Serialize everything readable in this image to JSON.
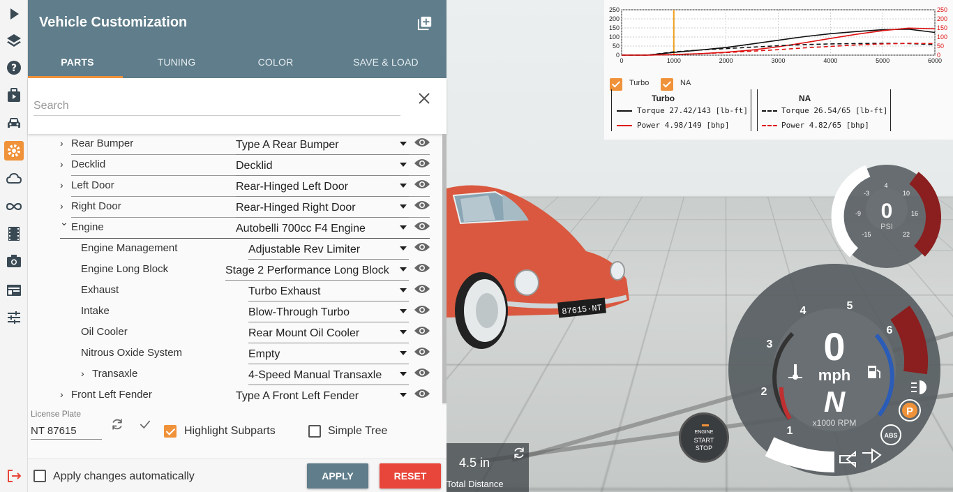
{
  "iconbar": {
    "items": [
      {
        "icon": "play-icon"
      },
      {
        "icon": "layers-icon"
      },
      {
        "icon": "help-icon"
      },
      {
        "icon": "mission-icon"
      },
      {
        "icon": "vehicle-icon"
      },
      {
        "icon": "gear-icon",
        "active": true
      },
      {
        "icon": "cloud-icon"
      },
      {
        "icon": "infinity-icon"
      },
      {
        "icon": "film-icon"
      },
      {
        "icon": "camera-icon"
      },
      {
        "icon": "layout-icon"
      },
      {
        "icon": "sliders-icon"
      }
    ],
    "exit_icon": "exit-icon"
  },
  "panel": {
    "title": "Vehicle Customization",
    "add_icon": "add-box-icon",
    "tabs": [
      "PARTS",
      "TUNING",
      "COLOR",
      "SAVE & LOAD"
    ],
    "active_tab": "PARTS",
    "search": {
      "placeholder": "Search",
      "value": ""
    },
    "parts": [
      {
        "name": "Rear Bumper",
        "value": "Type A Rear Bumper",
        "level": 0,
        "chevron": "›"
      },
      {
        "name": "Decklid",
        "value": "Decklid",
        "level": 0,
        "chevron": "›"
      },
      {
        "name": "Left Door",
        "value": "Rear-Hinged Left Door",
        "level": 0,
        "chevron": "›"
      },
      {
        "name": "Right Door",
        "value": "Rear-Hinged Right Door",
        "level": 0,
        "chevron": "›"
      },
      {
        "name": "Engine",
        "value": "Autobelli 700cc F4 Engine",
        "level": 0,
        "chevron": "⌄"
      },
      {
        "name": "Engine Management",
        "value": "Adjustable Rev Limiter",
        "level": 1
      },
      {
        "name": "Engine Long Block",
        "value": "Stage 2 Performance Long Block",
        "level": 1
      },
      {
        "name": "Exhaust",
        "value": "Turbo Exhaust",
        "level": 1
      },
      {
        "name": "Intake",
        "value": "Blow-Through Turbo",
        "level": 1
      },
      {
        "name": "Oil Cooler",
        "value": "Rear Mount Oil Cooler",
        "level": 1
      },
      {
        "name": "Nitrous Oxide System",
        "value": "Empty",
        "level": 1
      },
      {
        "name": "Transaxle",
        "value": "4-Speed Manual Transaxle",
        "level": 1,
        "chevron": "›"
      },
      {
        "name": "Front Left Fender",
        "value": "Type A Front Left Fender",
        "level": 0,
        "chevron": "›"
      }
    ],
    "license_plate": {
      "label": "License Plate",
      "value": "NT 87615"
    },
    "highlight_subparts": {
      "label": "Highlight Subparts",
      "checked": true
    },
    "simple_tree": {
      "label": "Simple Tree",
      "checked": false
    },
    "apply_auto": {
      "label": "Apply changes automatically",
      "checked": false
    },
    "apply_label": "APPLY",
    "reset_label": "RESET"
  },
  "chart": {
    "turbo_checkbox": "Turbo",
    "na_checkbox": "NA",
    "legend": {
      "turbo": {
        "title": "Turbo",
        "torque": "Torque 27.42/143 [lb-ft]",
        "power": "Power  4.98/149  [bhp]"
      },
      "na": {
        "title": "NA",
        "torque": "Torque 26.54/65 [lb-ft]",
        "power": "Power  4.82/65  [bhp]"
      }
    }
  },
  "chart_data": {
    "type": "line",
    "x_ticks": [
      "0",
      "1000",
      "2000",
      "3000",
      "4000",
      "5000",
      "6000"
    ],
    "y_left_ticks": [
      "250",
      "200",
      "150",
      "100",
      "50",
      "0"
    ],
    "y_right_ticks": [
      "250",
      "200",
      "150",
      "100",
      "50",
      "0"
    ],
    "xlim": [
      0,
      6000
    ],
    "ylim": [
      0,
      250
    ],
    "marker_rpm": 1000,
    "grid": true,
    "x": [
      0,
      500,
      1000,
      1500,
      2000,
      2500,
      3000,
      3500,
      4000,
      4500,
      5000,
      5500,
      6000
    ],
    "series": [
      {
        "name": "Turbo Torque",
        "values": [
          0,
          0,
          15,
          28,
          42,
          62,
          82,
          102,
          118,
          130,
          140,
          143,
          125
        ],
        "color": "#111111",
        "dash": false
      },
      {
        "name": "Turbo Power",
        "values": [
          0,
          0,
          3,
          8,
          16,
          28,
          46,
          68,
          92,
          115,
          135,
          149,
          145
        ],
        "color": "#dd1111",
        "dash": false
      },
      {
        "name": "NA Torque",
        "values": [
          0,
          0,
          18,
          28,
          36,
          44,
          52,
          58,
          62,
          64,
          65,
          64,
          58
        ],
        "color": "#111111",
        "dash": true
      },
      {
        "name": "NA Power",
        "values": [
          0,
          0,
          3,
          8,
          14,
          22,
          30,
          40,
          48,
          56,
          62,
          65,
          64
        ],
        "color": "#dd1111",
        "dash": true
      }
    ]
  },
  "hud": {
    "boost": {
      "value": "0",
      "unit": "PSI",
      "ticks": [
        "-15",
        "-9",
        "-3",
        "4",
        "10",
        "16",
        "22"
      ]
    },
    "speed": {
      "value": "0",
      "unit": "mph",
      "gear": "N",
      "rpm_label": "x1000 RPM",
      "rpm_ticks": [
        "1",
        "2",
        "3",
        "4",
        "5",
        "6"
      ]
    },
    "badges": {
      "parking": "P",
      "abs": "ABS"
    },
    "start_button": {
      "line1": "ENGINE",
      "line2": "START",
      "line3": "STOP"
    },
    "distance": {
      "value": "4.5 in",
      "label": "Total Distance"
    },
    "car_plate": "87615·NT"
  }
}
